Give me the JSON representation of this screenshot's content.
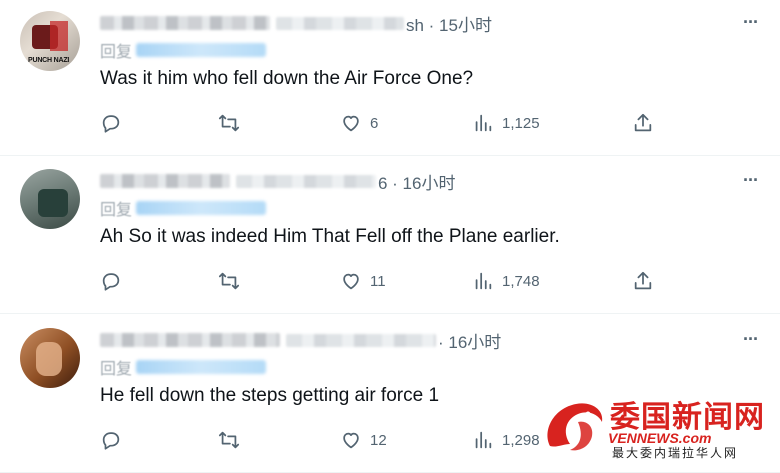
{
  "tweets": [
    {
      "time_suffix": "sh · 15小时",
      "reply_prefix": "回复",
      "text": "Was it him who fell down the Air Force One?",
      "likes": "6",
      "views": "1,125",
      "avatar_text": "PUNCH NAZI"
    },
    {
      "time_suffix": "6 · 16小时",
      "reply_prefix": "回复",
      "text": "Ah So it was indeed Him That Fell off the Plane earlier.",
      "likes": "11",
      "views": "1,748"
    },
    {
      "time_suffix": " · 16小时",
      "reply_prefix": "回复",
      "text": "He fell down the steps getting air force 1",
      "likes": "12",
      "views": "1,298"
    }
  ],
  "more_label": "···",
  "watermark": {
    "cn": "委国新闻网",
    "en": "VENNEWS.com",
    "sub": "最大委内瑞拉华人网",
    "color": "#d8231f"
  },
  "icons": [
    "reply-icon",
    "retweet-icon",
    "like-icon",
    "views-icon",
    "share-icon",
    "more-icon"
  ]
}
